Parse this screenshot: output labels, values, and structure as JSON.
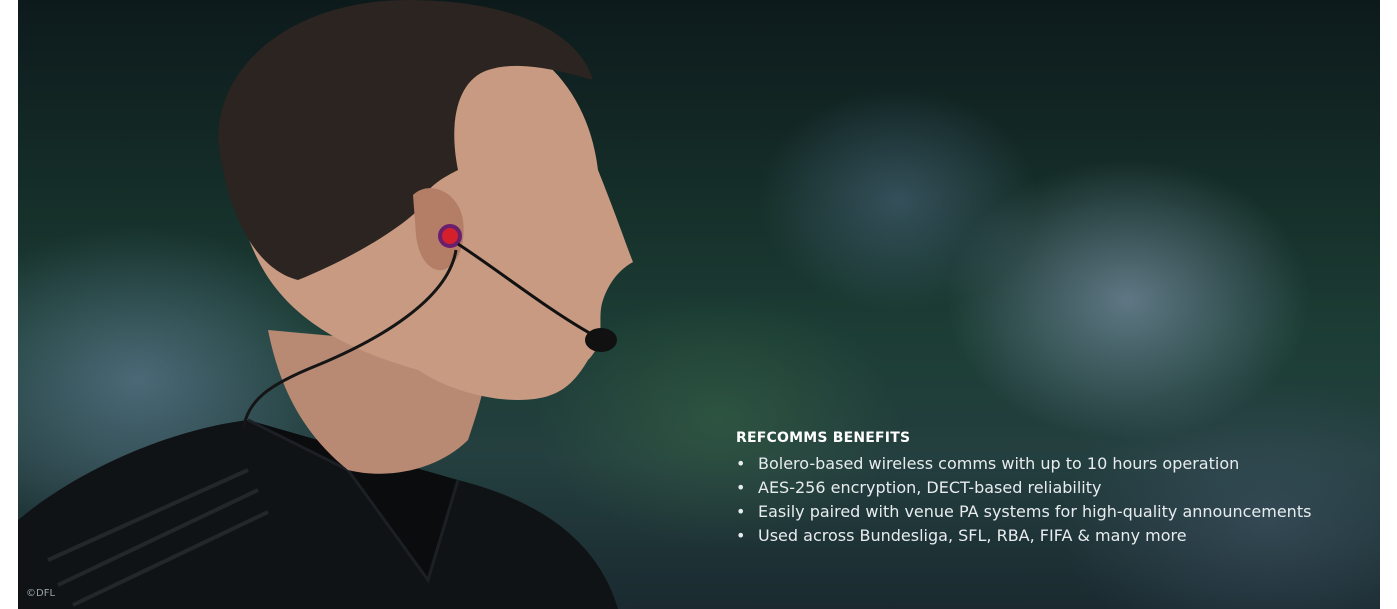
{
  "photo": {
    "subject_icon": "referee-with-headset-icon"
  },
  "benefits": {
    "title": "REFCOMMS BENEFITS",
    "items": [
      "Bolero-based wireless comms with up to 10 hours operation",
      "AES-256 encryption, DECT-based reliability",
      "Easily paired with venue PA systems for high-quality announcements",
      "Used across Bundesliga, SFL, RBA, FIFA & many more"
    ]
  },
  "credit": "©DFL",
  "colors": {
    "text": "#ffffff",
    "bullet_text": "#e8ecee",
    "earpiece_accent": "#d4202a"
  }
}
